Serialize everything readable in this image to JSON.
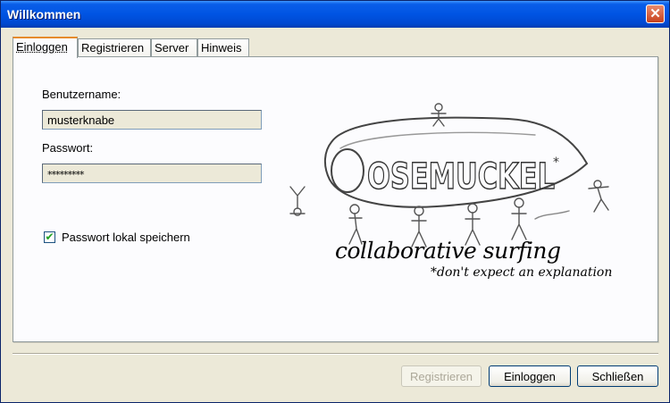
{
  "window": {
    "title": "Willkommen",
    "close_glyph": "✕"
  },
  "tabs": [
    {
      "label": "Einloggen",
      "active": true
    },
    {
      "label": "Registrieren",
      "active": false
    },
    {
      "label": "Server",
      "active": false
    },
    {
      "label": "Hinweis",
      "active": false
    }
  ],
  "form": {
    "username_label": "Benutzername:",
    "username_value": "musterknabe",
    "password_label": "Passwort:",
    "password_value": "*********",
    "remember_checked": true,
    "remember_label": "Passwort lokal speichern",
    "check_glyph": "✔"
  },
  "logo": {
    "name_text": "OSEMUCKEL",
    "asterisk": "*",
    "caption": "collaborative surfing",
    "subcaption": "*don't expect an explanation"
  },
  "buttons": {
    "register_label": "Registrieren",
    "register_disabled": true,
    "login_label": "Einloggen",
    "close_label": "Schließen"
  }
}
